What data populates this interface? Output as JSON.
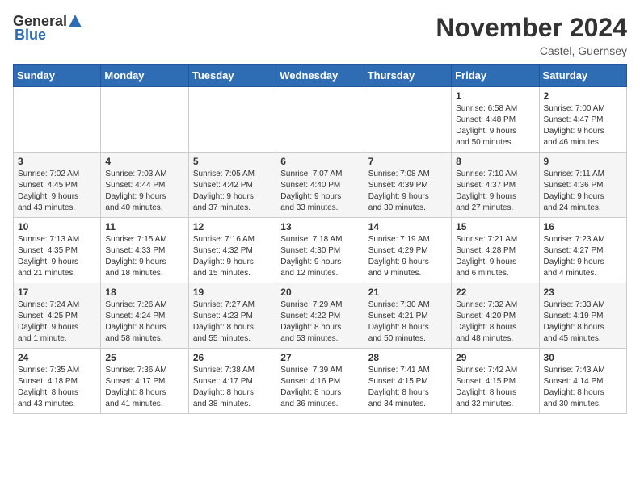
{
  "header": {
    "logo_general": "General",
    "logo_blue": "Blue",
    "month_title": "November 2024",
    "location": "Castel, Guernsey"
  },
  "weekdays": [
    "Sunday",
    "Monday",
    "Tuesday",
    "Wednesday",
    "Thursday",
    "Friday",
    "Saturday"
  ],
  "weeks": [
    [
      {
        "day": "",
        "info": ""
      },
      {
        "day": "",
        "info": ""
      },
      {
        "day": "",
        "info": ""
      },
      {
        "day": "",
        "info": ""
      },
      {
        "day": "",
        "info": ""
      },
      {
        "day": "1",
        "info": "Sunrise: 6:58 AM\nSunset: 4:48 PM\nDaylight: 9 hours\nand 50 minutes."
      },
      {
        "day": "2",
        "info": "Sunrise: 7:00 AM\nSunset: 4:47 PM\nDaylight: 9 hours\nand 46 minutes."
      }
    ],
    [
      {
        "day": "3",
        "info": "Sunrise: 7:02 AM\nSunset: 4:45 PM\nDaylight: 9 hours\nand 43 minutes."
      },
      {
        "day": "4",
        "info": "Sunrise: 7:03 AM\nSunset: 4:44 PM\nDaylight: 9 hours\nand 40 minutes."
      },
      {
        "day": "5",
        "info": "Sunrise: 7:05 AM\nSunset: 4:42 PM\nDaylight: 9 hours\nand 37 minutes."
      },
      {
        "day": "6",
        "info": "Sunrise: 7:07 AM\nSunset: 4:40 PM\nDaylight: 9 hours\nand 33 minutes."
      },
      {
        "day": "7",
        "info": "Sunrise: 7:08 AM\nSunset: 4:39 PM\nDaylight: 9 hours\nand 30 minutes."
      },
      {
        "day": "8",
        "info": "Sunrise: 7:10 AM\nSunset: 4:37 PM\nDaylight: 9 hours\nand 27 minutes."
      },
      {
        "day": "9",
        "info": "Sunrise: 7:11 AM\nSunset: 4:36 PM\nDaylight: 9 hours\nand 24 minutes."
      }
    ],
    [
      {
        "day": "10",
        "info": "Sunrise: 7:13 AM\nSunset: 4:35 PM\nDaylight: 9 hours\nand 21 minutes."
      },
      {
        "day": "11",
        "info": "Sunrise: 7:15 AM\nSunset: 4:33 PM\nDaylight: 9 hours\nand 18 minutes."
      },
      {
        "day": "12",
        "info": "Sunrise: 7:16 AM\nSunset: 4:32 PM\nDaylight: 9 hours\nand 15 minutes."
      },
      {
        "day": "13",
        "info": "Sunrise: 7:18 AM\nSunset: 4:30 PM\nDaylight: 9 hours\nand 12 minutes."
      },
      {
        "day": "14",
        "info": "Sunrise: 7:19 AM\nSunset: 4:29 PM\nDaylight: 9 hours\nand 9 minutes."
      },
      {
        "day": "15",
        "info": "Sunrise: 7:21 AM\nSunset: 4:28 PM\nDaylight: 9 hours\nand 6 minutes."
      },
      {
        "day": "16",
        "info": "Sunrise: 7:23 AM\nSunset: 4:27 PM\nDaylight: 9 hours\nand 4 minutes."
      }
    ],
    [
      {
        "day": "17",
        "info": "Sunrise: 7:24 AM\nSunset: 4:25 PM\nDaylight: 9 hours\nand 1 minute."
      },
      {
        "day": "18",
        "info": "Sunrise: 7:26 AM\nSunset: 4:24 PM\nDaylight: 8 hours\nand 58 minutes."
      },
      {
        "day": "19",
        "info": "Sunrise: 7:27 AM\nSunset: 4:23 PM\nDaylight: 8 hours\nand 55 minutes."
      },
      {
        "day": "20",
        "info": "Sunrise: 7:29 AM\nSunset: 4:22 PM\nDaylight: 8 hours\nand 53 minutes."
      },
      {
        "day": "21",
        "info": "Sunrise: 7:30 AM\nSunset: 4:21 PM\nDaylight: 8 hours\nand 50 minutes."
      },
      {
        "day": "22",
        "info": "Sunrise: 7:32 AM\nSunset: 4:20 PM\nDaylight: 8 hours\nand 48 minutes."
      },
      {
        "day": "23",
        "info": "Sunrise: 7:33 AM\nSunset: 4:19 PM\nDaylight: 8 hours\nand 45 minutes."
      }
    ],
    [
      {
        "day": "24",
        "info": "Sunrise: 7:35 AM\nSunset: 4:18 PM\nDaylight: 8 hours\nand 43 minutes."
      },
      {
        "day": "25",
        "info": "Sunrise: 7:36 AM\nSunset: 4:17 PM\nDaylight: 8 hours\nand 41 minutes."
      },
      {
        "day": "26",
        "info": "Sunrise: 7:38 AM\nSunset: 4:17 PM\nDaylight: 8 hours\nand 38 minutes."
      },
      {
        "day": "27",
        "info": "Sunrise: 7:39 AM\nSunset: 4:16 PM\nDaylight: 8 hours\nand 36 minutes."
      },
      {
        "day": "28",
        "info": "Sunrise: 7:41 AM\nSunset: 4:15 PM\nDaylight: 8 hours\nand 34 minutes."
      },
      {
        "day": "29",
        "info": "Sunrise: 7:42 AM\nSunset: 4:15 PM\nDaylight: 8 hours\nand 32 minutes."
      },
      {
        "day": "30",
        "info": "Sunrise: 7:43 AM\nSunset: 4:14 PM\nDaylight: 8 hours\nand 30 minutes."
      }
    ]
  ]
}
